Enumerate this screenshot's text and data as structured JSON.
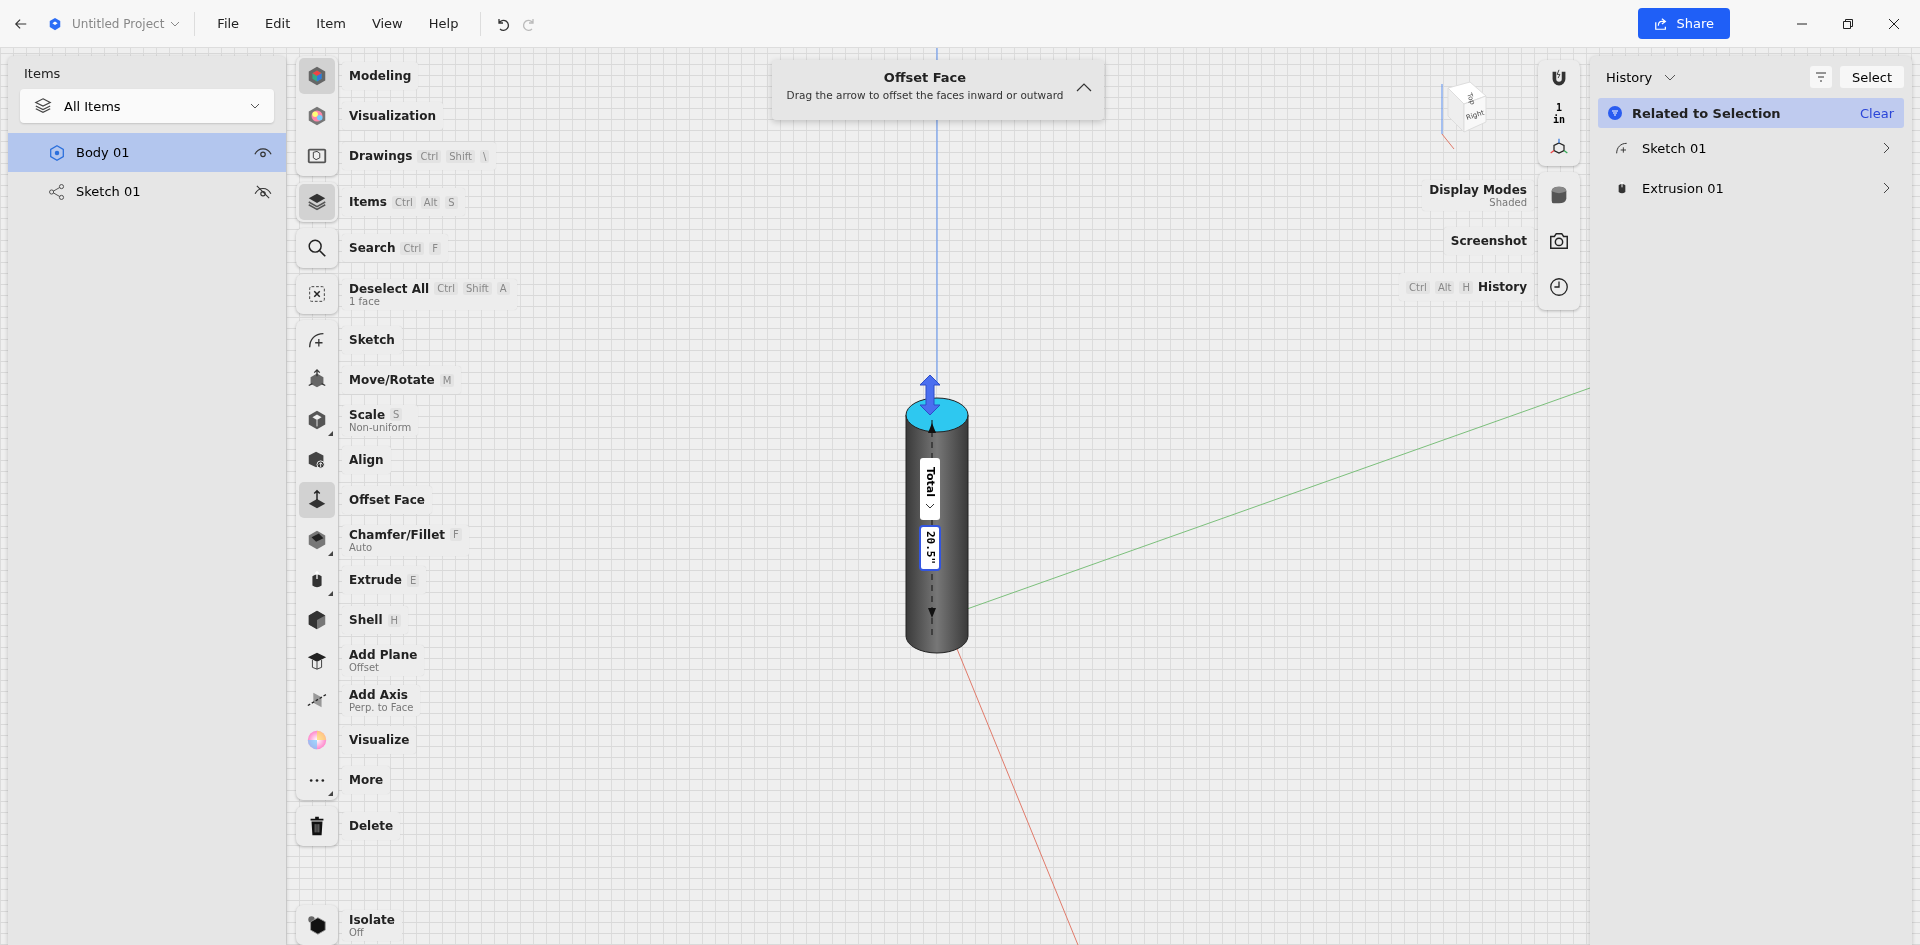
{
  "title_bar": {
    "project": "Untitled Project",
    "menu": [
      "File",
      "Edit",
      "Item",
      "View",
      "Help"
    ],
    "undo": {
      "disabled": false
    },
    "redo": {
      "disabled": true
    },
    "share": "Share"
  },
  "items_panel": {
    "title": "Items",
    "filter": "All Items",
    "items": [
      {
        "name": "Body 01",
        "kind": "body",
        "selected": true,
        "visible": true
      },
      {
        "name": "Sketch 01",
        "kind": "sketch",
        "selected": false,
        "visible": false
      }
    ]
  },
  "toolbar": [
    {
      "items": [
        {
          "label": "Modeling",
          "selected": true,
          "submenu": false
        },
        {
          "label": "Visualization",
          "selected": false,
          "submenu": false
        },
        {
          "label": "Drawings",
          "keys": [
            "Ctrl",
            "Shift",
            "\\"
          ],
          "selected": false,
          "submenu": false
        }
      ]
    },
    {
      "items": [
        {
          "label": "Items",
          "keys": [
            "Ctrl",
            "Alt",
            "S"
          ],
          "selected": true,
          "submenu": false
        }
      ]
    },
    {
      "items": [
        {
          "label": "Search",
          "keys": [
            "Ctrl",
            "F"
          ],
          "selected": false,
          "submenu": false
        }
      ]
    },
    {
      "items": [
        {
          "label": "Deselect All",
          "keys": [
            "Ctrl",
            "Shift",
            "A"
          ],
          "subtitle": "1 face",
          "selected": false,
          "submenu": false
        }
      ]
    },
    {
      "items": [
        {
          "label": "Sketch",
          "selected": false,
          "submenu": false
        },
        {
          "label": "Move/Rotate",
          "keys": [
            "M"
          ],
          "selected": false,
          "submenu": false
        },
        {
          "label": "Scale",
          "keys": [
            "S"
          ],
          "subtitle": "Non-uniform",
          "selected": false,
          "submenu": true
        },
        {
          "label": "Align",
          "selected": false,
          "submenu": false
        },
        {
          "label": "Offset Face",
          "selected": true,
          "submenu": false
        },
        {
          "label": "Chamfer/Fillet",
          "keys": [
            "F"
          ],
          "subtitle": "Auto",
          "selected": false,
          "submenu": true
        },
        {
          "label": "Extrude",
          "keys": [
            "E"
          ],
          "selected": false,
          "submenu": true
        },
        {
          "label": "Shell",
          "keys": [
            "H"
          ],
          "selected": false,
          "submenu": false
        },
        {
          "label": "Add Plane",
          "subtitle": "Offset",
          "selected": false,
          "submenu": false
        },
        {
          "label": "Add Axis",
          "subtitle": "Perp. to Face",
          "selected": false,
          "submenu": false
        },
        {
          "label": "Visualize",
          "selected": false,
          "submenu": false
        },
        {
          "label": "More",
          "selected": false,
          "submenu": true
        }
      ]
    },
    {
      "items": [
        {
          "label": "Delete",
          "selected": false,
          "submenu": false
        }
      ]
    },
    {
      "items": [
        {
          "label": "Isolate",
          "subtitle": "Off",
          "selected": false,
          "submenu": false
        }
      ]
    }
  ],
  "prompt": {
    "title": "Offset Face",
    "text": "Drag the arrow to offset the faces inward or outward"
  },
  "view_cube": {
    "faces": [
      "Top",
      "Right"
    ]
  },
  "units": {
    "value": "1",
    "unit": "in"
  },
  "side_tools": [
    {
      "label": "Display Modes",
      "subtitle": "Shaded"
    },
    {
      "label": "Screenshot"
    },
    {
      "label": "History",
      "keys": [
        "Ctrl",
        "Alt",
        "H"
      ]
    }
  ],
  "dimension": {
    "mode": "Total",
    "value": "20.5\""
  },
  "history_panel": {
    "title": "History",
    "select": "Select",
    "filter": {
      "label": "Related to Selection",
      "clear": "Clear"
    },
    "entries": [
      {
        "name": "Sketch 01",
        "kind": "sketch"
      },
      {
        "name": "Extrusion 01",
        "kind": "extrusion"
      }
    ]
  }
}
